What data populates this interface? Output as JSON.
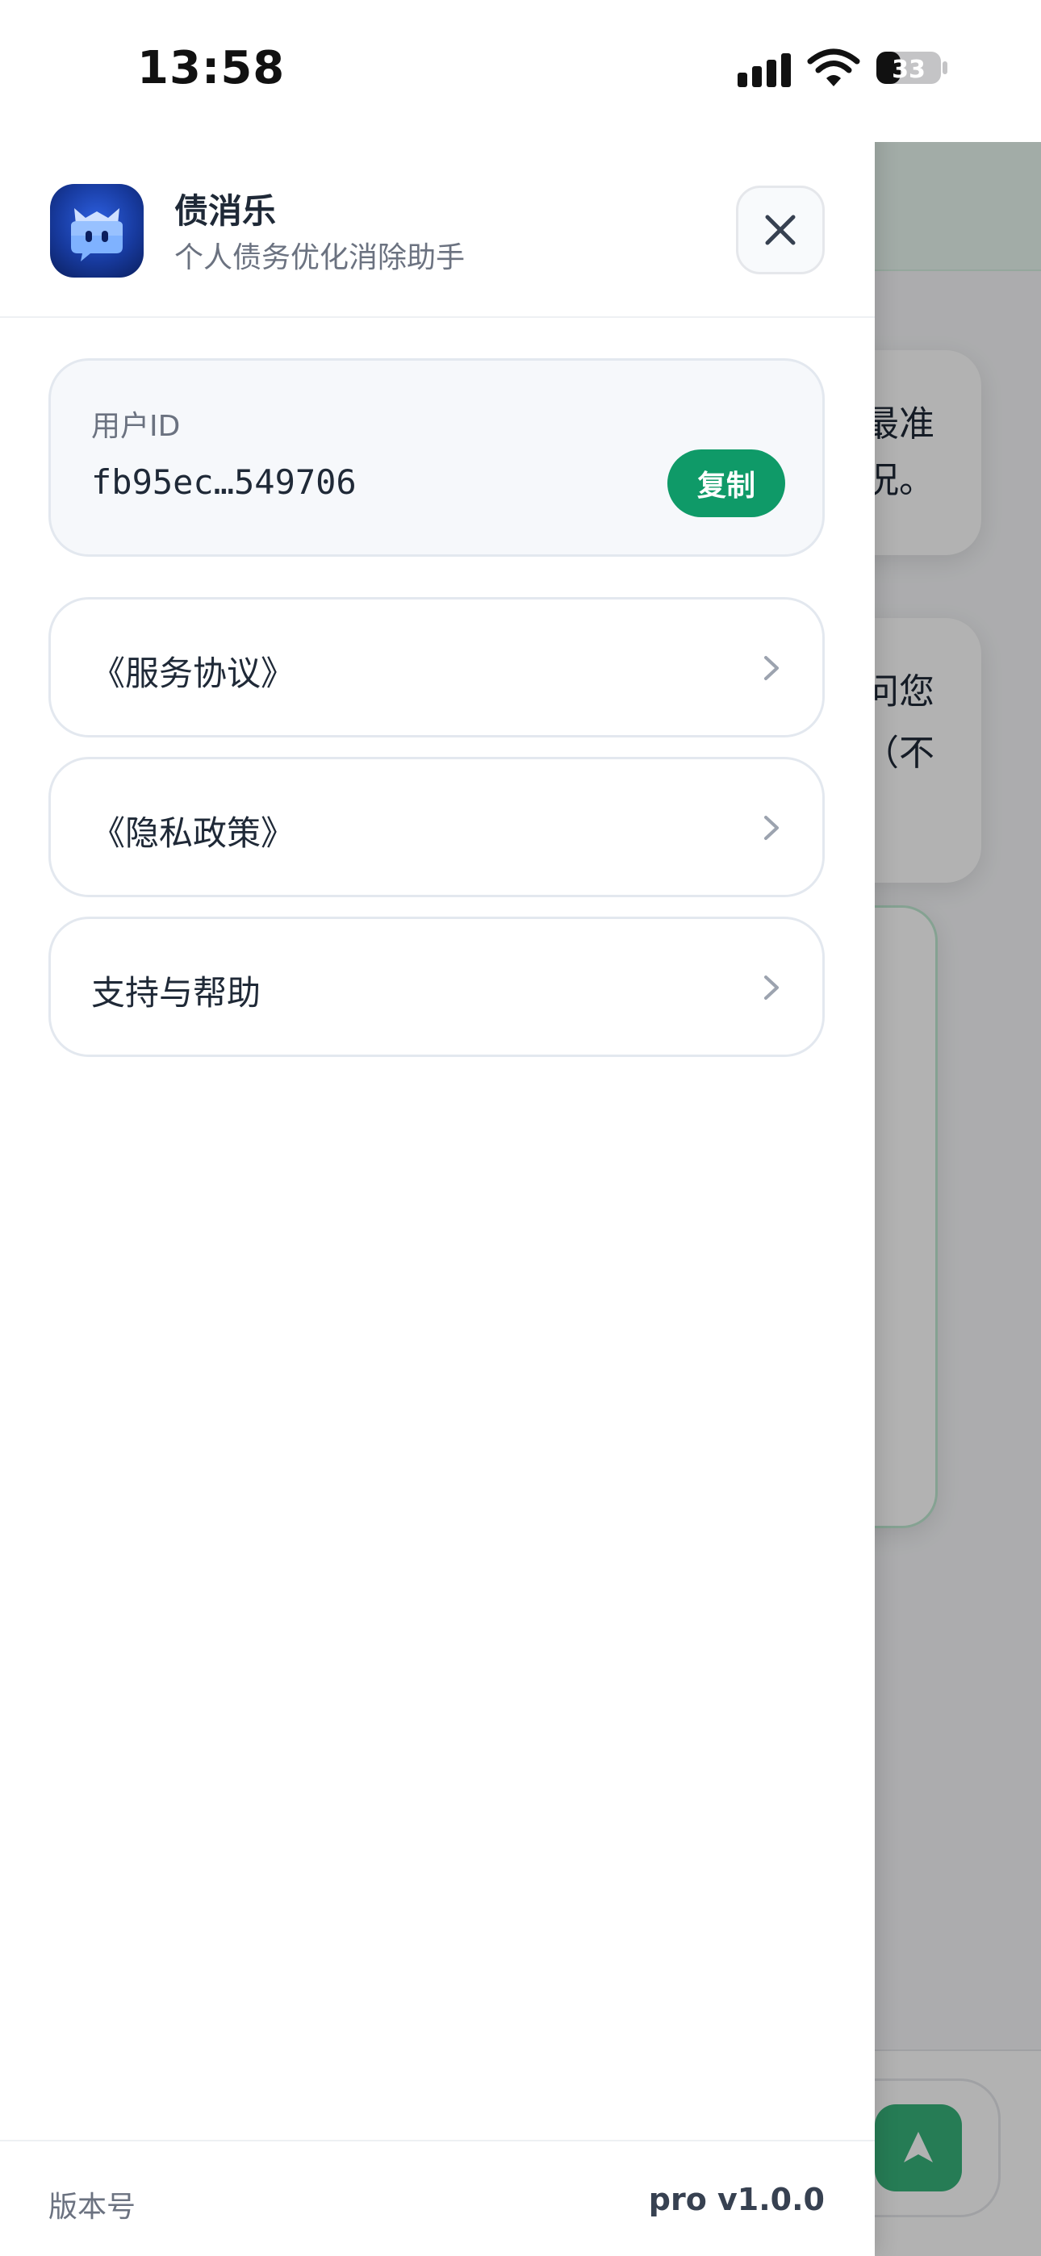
{
  "status_bar": {
    "time": "13:58",
    "battery_level": "33",
    "icons": [
      "signal-icon",
      "wifi-icon",
      "battery-icon"
    ]
  },
  "drawer": {
    "app_name": "债消乐",
    "app_tagline": "个人债务优化消除助手",
    "logo_icon": "robot-chat-logo-icon",
    "close_icon": "close-icon",
    "user_id": {
      "label": "用户ID",
      "value": "fb95ec…549706",
      "copy_label": "复制"
    },
    "menu": [
      {
        "label": "《服务协议》",
        "icon": "chevron-right-icon"
      },
      {
        "label": "《隐私政策》",
        "icon": "chevron-right-icon"
      },
      {
        "label": "支持与帮助",
        "icon": "chevron-right-icon"
      }
    ],
    "footer": {
      "version_label": "版本号",
      "version_value": "pro v1.0.0"
    }
  },
  "background": {
    "card_1_lines": [
      "最准",
      "况。"
    ],
    "card_2_lines": [
      "问您",
      "（不"
    ],
    "send_icon": "send-icon"
  },
  "colors": {
    "accent_green": "#0f9a68",
    "logo_blue": "#173a9e",
    "text_primary": "#1f2937",
    "text_secondary": "#6b7280"
  }
}
